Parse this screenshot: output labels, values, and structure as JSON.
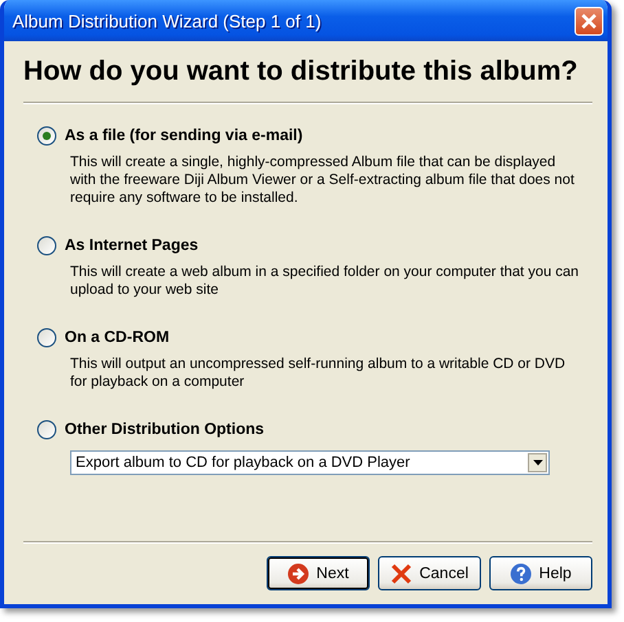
{
  "window": {
    "title": "Album Distribution Wizard (Step 1 of 1)"
  },
  "heading": "How do you want to distribute this album?",
  "options": [
    {
      "label": "As a file (for sending via e-mail)",
      "selected": true,
      "description": "This will create a single, highly-compressed Album file that can be displayed with the freeware Diji Album Viewer or a Self-extracting album file that does not require any software to be installed."
    },
    {
      "label": "As Internet Pages",
      "selected": false,
      "description": "This will create a web album in a specified folder on your computer that you can upload to your web site"
    },
    {
      "label": "On a CD-ROM",
      "selected": false,
      "description": "This will output an uncompressed self-running album to a writable CD or DVD for playback on a computer"
    },
    {
      "label": "Other Distribution Options",
      "selected": false,
      "dropdown": "Export album to CD for playback on a DVD Player"
    }
  ],
  "buttons": [
    {
      "kind": "next",
      "label": "Next",
      "default": true
    },
    {
      "kind": "cancel",
      "label": "Cancel",
      "default": false
    },
    {
      "kind": "help",
      "label": "Help",
      "default": false
    }
  ]
}
